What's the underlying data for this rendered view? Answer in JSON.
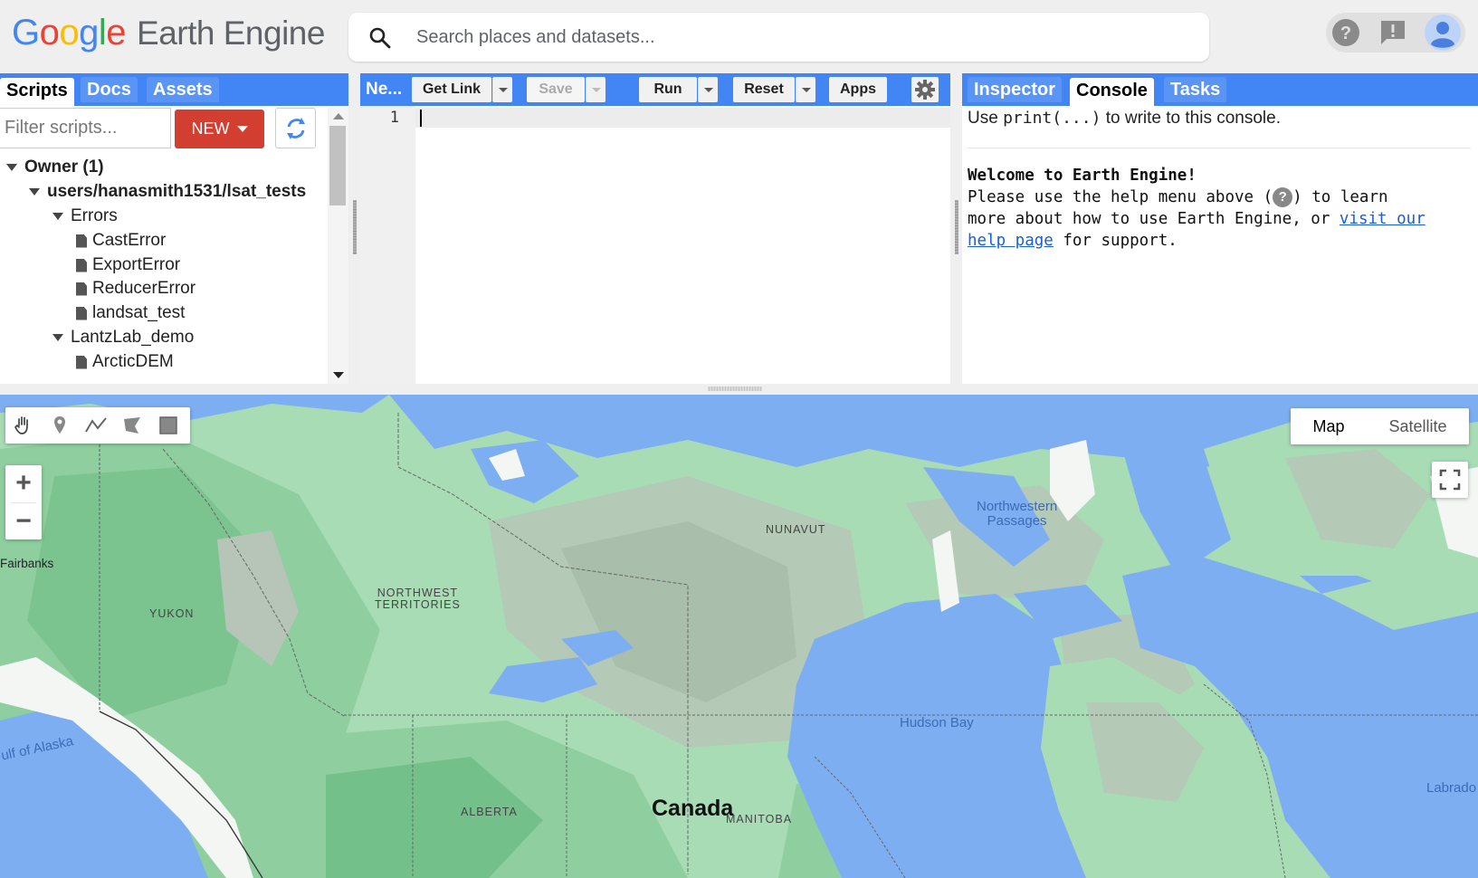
{
  "header": {
    "logo_google": [
      "G",
      "o",
      "o",
      "g",
      "l",
      "e"
    ],
    "logo_colors": [
      "#4285f4",
      "#ea4335",
      "#fbbc05",
      "#4285f4",
      "#34a853",
      "#ea4335"
    ],
    "logo_product": "Earth Engine",
    "search_placeholder": "Search places and datasets...",
    "icons": [
      "help-icon",
      "feedback-icon",
      "account-avatar-icon"
    ]
  },
  "left_panel": {
    "tabs": [
      {
        "label": "Scripts",
        "active": true
      },
      {
        "label": "Docs",
        "active": false
      },
      {
        "label": "Assets",
        "active": false
      }
    ],
    "filter_placeholder": "Filter scripts...",
    "new_label": "NEW",
    "tree": [
      {
        "label": "Owner (1)",
        "kind": "folder",
        "depth": 0
      },
      {
        "label": "users/hanasmith1531/lsat_tests",
        "kind": "folder",
        "depth": 1
      },
      {
        "label": "Errors",
        "kind": "folder",
        "depth": 2
      },
      {
        "label": "CastError",
        "kind": "file",
        "depth": 3
      },
      {
        "label": "ExportError",
        "kind": "file",
        "depth": 3
      },
      {
        "label": "ReducerError",
        "kind": "file",
        "depth": 3
      },
      {
        "label": "landsat_test",
        "kind": "file",
        "depth": 3
      },
      {
        "label": "LantzLab_demo",
        "kind": "folder",
        "depth": 2
      },
      {
        "label": "ArcticDEM",
        "kind": "file",
        "depth": 3
      }
    ]
  },
  "editor": {
    "script_name": "Ne...",
    "buttons": {
      "get_link": "Get Link",
      "save": "Save",
      "run": "Run",
      "reset": "Reset",
      "apps": "Apps"
    },
    "line_number": "1",
    "code": ""
  },
  "right_panel": {
    "tabs": [
      {
        "label": "Inspector",
        "active": false
      },
      {
        "label": "Console",
        "active": true
      },
      {
        "label": "Tasks",
        "active": false
      }
    ],
    "console_hint_pre": "Use ",
    "console_hint_code": "print(...)",
    "console_hint_post": " to write to this console.",
    "welcome_title": "Welcome to Earth Engine!",
    "welcome_line1_pre": "Please use the help menu above (",
    "welcome_line1_glyph": "?",
    "welcome_line1_post": ") to learn",
    "welcome_line2_pre": "more about how to use Earth Engine, or ",
    "welcome_link": "visit our help page",
    "welcome_line2_post": " for support."
  },
  "map": {
    "maptype_options": [
      "Map",
      "Satellite"
    ],
    "maptype_selected": "Map",
    "draw_tools": [
      "hand-tool-icon",
      "marker-tool-icon",
      "line-tool-icon",
      "polygon-tool-icon",
      "rectangle-tool-icon"
    ],
    "zoom_in": "+",
    "zoom_out": "−",
    "labels": {
      "nunavut": "NUNAVUT",
      "northwest_territories": "NORTHWEST\nTERRITORIES",
      "yukon": "YUKON",
      "fairbanks": "Fairbanks",
      "northwestern_passages": "Northwestern\nPassages",
      "hudson_bay": "Hudson Bay",
      "gulf_of_alaska": "ulf of Alaska",
      "canada": "Canada",
      "alberta": "ALBERTA",
      "manitoba": "MANITOBA",
      "labrador": "Labrado"
    },
    "colors": {
      "water": "#7eaef2",
      "land_light": "#a7dcb5",
      "land_mid": "#8fcf9f",
      "land_dark": "#74c08a",
      "tundra": "#b4c9b6",
      "ice": "#f3f6f3"
    }
  },
  "colors": {
    "accent": "#4285f4",
    "new_button": "#d23f31"
  }
}
